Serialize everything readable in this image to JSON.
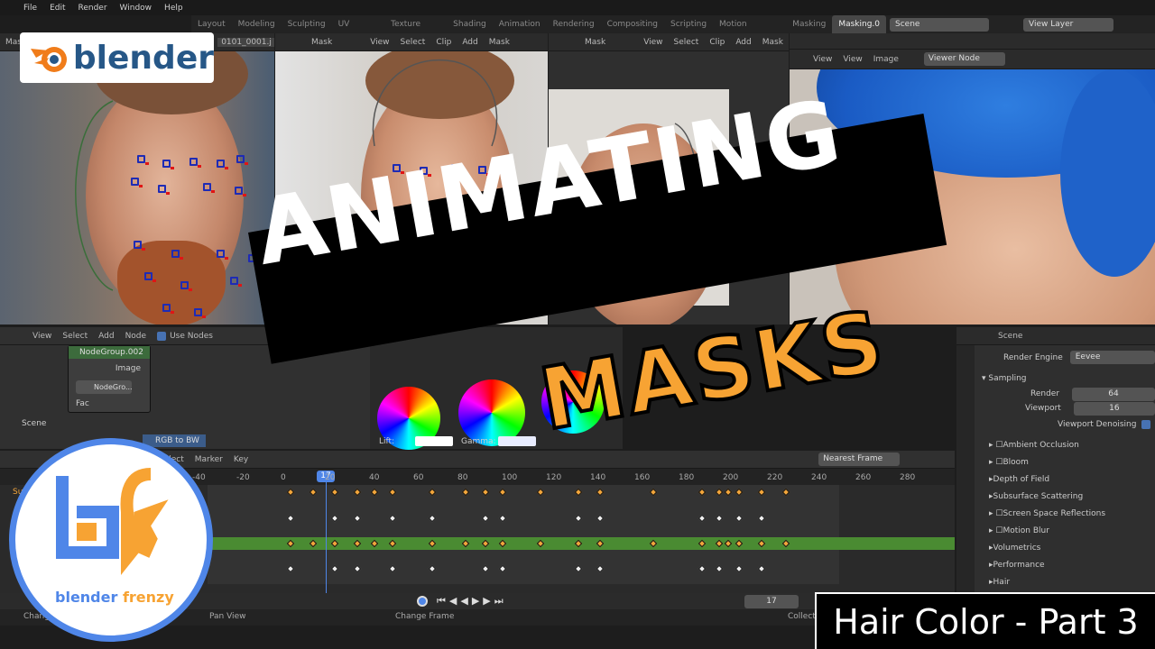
{
  "menu": {
    "items": [
      "File",
      "Edit",
      "Render",
      "Window",
      "Help"
    ]
  },
  "workspace_tabs": [
    "Layout",
    "Modeling",
    "Sculpting",
    "UV Editing",
    "Texture Paint",
    "Shading",
    "Animation",
    "Rendering",
    "Compositing",
    "Scripting",
    "Motion Tracking",
    "Masking",
    "Masking.0"
  ],
  "scene": {
    "name": "Scene",
    "view_layer": "View Layer"
  },
  "clip_editors": [
    {
      "mode": "Mask",
      "file": "0101_0001.j",
      "menus": [
        "View",
        "Select",
        "Clip",
        "Add",
        "Mask"
      ]
    },
    {
      "mode": "Mask",
      "menus": [
        "View",
        "Select",
        "Clip",
        "Add",
        "Mask"
      ]
    },
    {
      "mode": "Mask",
      "menus": [
        "View",
        "Select",
        "Clip",
        "Add",
        "Mask"
      ]
    }
  ],
  "image_editor": {
    "menus": [
      "View",
      "View",
      "Image"
    ],
    "image": "Viewer Node"
  },
  "node_editor": {
    "menus": [
      "View",
      "Select",
      "Add",
      "Node"
    ],
    "use_nodes_label": "Use Nodes",
    "group_node": "NodeGroup.002",
    "group_output": "Image",
    "group_ref": "NodeGro...",
    "fac_label": "Fac",
    "scene_label": "Scene",
    "rgb_to_bw": "RGB to BW",
    "lift_label": "Lift:",
    "gamma_label": "Gamma:"
  },
  "dopesheet": {
    "menus": [
      "Select",
      "Marker",
      "Key"
    ],
    "snap": "Nearest Frame",
    "frame_ticks": [
      "-40",
      "-20",
      "0",
      "20",
      "40",
      "60",
      "80",
      "100",
      "120",
      "140",
      "160",
      "180",
      "200",
      "220",
      "240",
      "260",
      "280"
    ],
    "current_frame": "17",
    "summary_label": "Sum"
  },
  "timeline": {
    "current_frame": "17"
  },
  "status_bar": {
    "left": "Change",
    "middle": "Pan View",
    "right": "Change Frame",
    "far": "Collect"
  },
  "properties": {
    "context": "Scene",
    "render_engine_label": "Render Engine",
    "render_engine": "Eevee",
    "sampling_label": "Sampling",
    "render_label": "Render",
    "render_samples": "64",
    "viewport_label": "Viewport",
    "viewport_samples": "16",
    "viewport_denoising": "Viewport Denoising",
    "sections": [
      "Ambient Occlusion",
      "Bloom",
      "Depth of Field",
      "Subsurface Scattering",
      "Screen Space Reflections",
      "Motion Blur",
      "Volumetrics",
      "Performance",
      "Hair"
    ]
  },
  "overlay": {
    "brand": "blender",
    "title_line1": "ANIMATING",
    "title_line2": "MASKS",
    "channel_name": "blender",
    "channel_name2": "frenzy",
    "subtitle": "Hair Color - Part 3"
  },
  "colors": {
    "accent_orange": "#f7a333",
    "brand_blue": "#4f86e8",
    "keyframe_orange": "#f2a53b",
    "green_channel": "#4a8b32"
  }
}
